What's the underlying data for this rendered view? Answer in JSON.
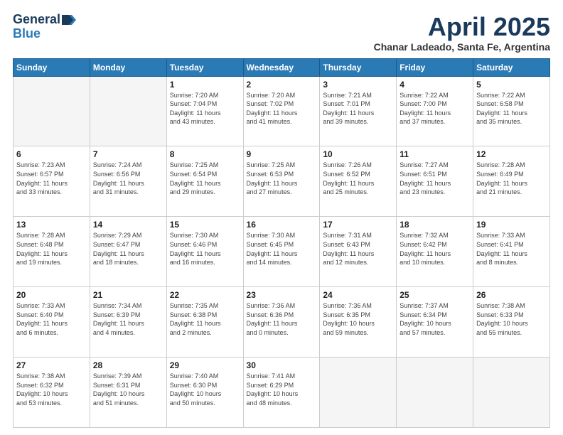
{
  "header": {
    "logo_general": "General",
    "logo_blue": "Blue",
    "month": "April 2025",
    "location": "Chanar Ladeado, Santa Fe, Argentina"
  },
  "weekdays": [
    "Sunday",
    "Monday",
    "Tuesday",
    "Wednesday",
    "Thursday",
    "Friday",
    "Saturday"
  ],
  "weeks": [
    [
      {
        "day": "",
        "text": ""
      },
      {
        "day": "",
        "text": ""
      },
      {
        "day": "1",
        "text": "Sunrise: 7:20 AM\nSunset: 7:04 PM\nDaylight: 11 hours\nand 43 minutes."
      },
      {
        "day": "2",
        "text": "Sunrise: 7:20 AM\nSunset: 7:02 PM\nDaylight: 11 hours\nand 41 minutes."
      },
      {
        "day": "3",
        "text": "Sunrise: 7:21 AM\nSunset: 7:01 PM\nDaylight: 11 hours\nand 39 minutes."
      },
      {
        "day": "4",
        "text": "Sunrise: 7:22 AM\nSunset: 7:00 PM\nDaylight: 11 hours\nand 37 minutes."
      },
      {
        "day": "5",
        "text": "Sunrise: 7:22 AM\nSunset: 6:58 PM\nDaylight: 11 hours\nand 35 minutes."
      }
    ],
    [
      {
        "day": "6",
        "text": "Sunrise: 7:23 AM\nSunset: 6:57 PM\nDaylight: 11 hours\nand 33 minutes."
      },
      {
        "day": "7",
        "text": "Sunrise: 7:24 AM\nSunset: 6:56 PM\nDaylight: 11 hours\nand 31 minutes."
      },
      {
        "day": "8",
        "text": "Sunrise: 7:25 AM\nSunset: 6:54 PM\nDaylight: 11 hours\nand 29 minutes."
      },
      {
        "day": "9",
        "text": "Sunrise: 7:25 AM\nSunset: 6:53 PM\nDaylight: 11 hours\nand 27 minutes."
      },
      {
        "day": "10",
        "text": "Sunrise: 7:26 AM\nSunset: 6:52 PM\nDaylight: 11 hours\nand 25 minutes."
      },
      {
        "day": "11",
        "text": "Sunrise: 7:27 AM\nSunset: 6:51 PM\nDaylight: 11 hours\nand 23 minutes."
      },
      {
        "day": "12",
        "text": "Sunrise: 7:28 AM\nSunset: 6:49 PM\nDaylight: 11 hours\nand 21 minutes."
      }
    ],
    [
      {
        "day": "13",
        "text": "Sunrise: 7:28 AM\nSunset: 6:48 PM\nDaylight: 11 hours\nand 19 minutes."
      },
      {
        "day": "14",
        "text": "Sunrise: 7:29 AM\nSunset: 6:47 PM\nDaylight: 11 hours\nand 18 minutes."
      },
      {
        "day": "15",
        "text": "Sunrise: 7:30 AM\nSunset: 6:46 PM\nDaylight: 11 hours\nand 16 minutes."
      },
      {
        "day": "16",
        "text": "Sunrise: 7:30 AM\nSunset: 6:45 PM\nDaylight: 11 hours\nand 14 minutes."
      },
      {
        "day": "17",
        "text": "Sunrise: 7:31 AM\nSunset: 6:43 PM\nDaylight: 11 hours\nand 12 minutes."
      },
      {
        "day": "18",
        "text": "Sunrise: 7:32 AM\nSunset: 6:42 PM\nDaylight: 11 hours\nand 10 minutes."
      },
      {
        "day": "19",
        "text": "Sunrise: 7:33 AM\nSunset: 6:41 PM\nDaylight: 11 hours\nand 8 minutes."
      }
    ],
    [
      {
        "day": "20",
        "text": "Sunrise: 7:33 AM\nSunset: 6:40 PM\nDaylight: 11 hours\nand 6 minutes."
      },
      {
        "day": "21",
        "text": "Sunrise: 7:34 AM\nSunset: 6:39 PM\nDaylight: 11 hours\nand 4 minutes."
      },
      {
        "day": "22",
        "text": "Sunrise: 7:35 AM\nSunset: 6:38 PM\nDaylight: 11 hours\nand 2 minutes."
      },
      {
        "day": "23",
        "text": "Sunrise: 7:36 AM\nSunset: 6:36 PM\nDaylight: 11 hours\nand 0 minutes."
      },
      {
        "day": "24",
        "text": "Sunrise: 7:36 AM\nSunset: 6:35 PM\nDaylight: 10 hours\nand 59 minutes."
      },
      {
        "day": "25",
        "text": "Sunrise: 7:37 AM\nSunset: 6:34 PM\nDaylight: 10 hours\nand 57 minutes."
      },
      {
        "day": "26",
        "text": "Sunrise: 7:38 AM\nSunset: 6:33 PM\nDaylight: 10 hours\nand 55 minutes."
      }
    ],
    [
      {
        "day": "27",
        "text": "Sunrise: 7:38 AM\nSunset: 6:32 PM\nDaylight: 10 hours\nand 53 minutes."
      },
      {
        "day": "28",
        "text": "Sunrise: 7:39 AM\nSunset: 6:31 PM\nDaylight: 10 hours\nand 51 minutes."
      },
      {
        "day": "29",
        "text": "Sunrise: 7:40 AM\nSunset: 6:30 PM\nDaylight: 10 hours\nand 50 minutes."
      },
      {
        "day": "30",
        "text": "Sunrise: 7:41 AM\nSunset: 6:29 PM\nDaylight: 10 hours\nand 48 minutes."
      },
      {
        "day": "",
        "text": ""
      },
      {
        "day": "",
        "text": ""
      },
      {
        "day": "",
        "text": ""
      }
    ]
  ]
}
